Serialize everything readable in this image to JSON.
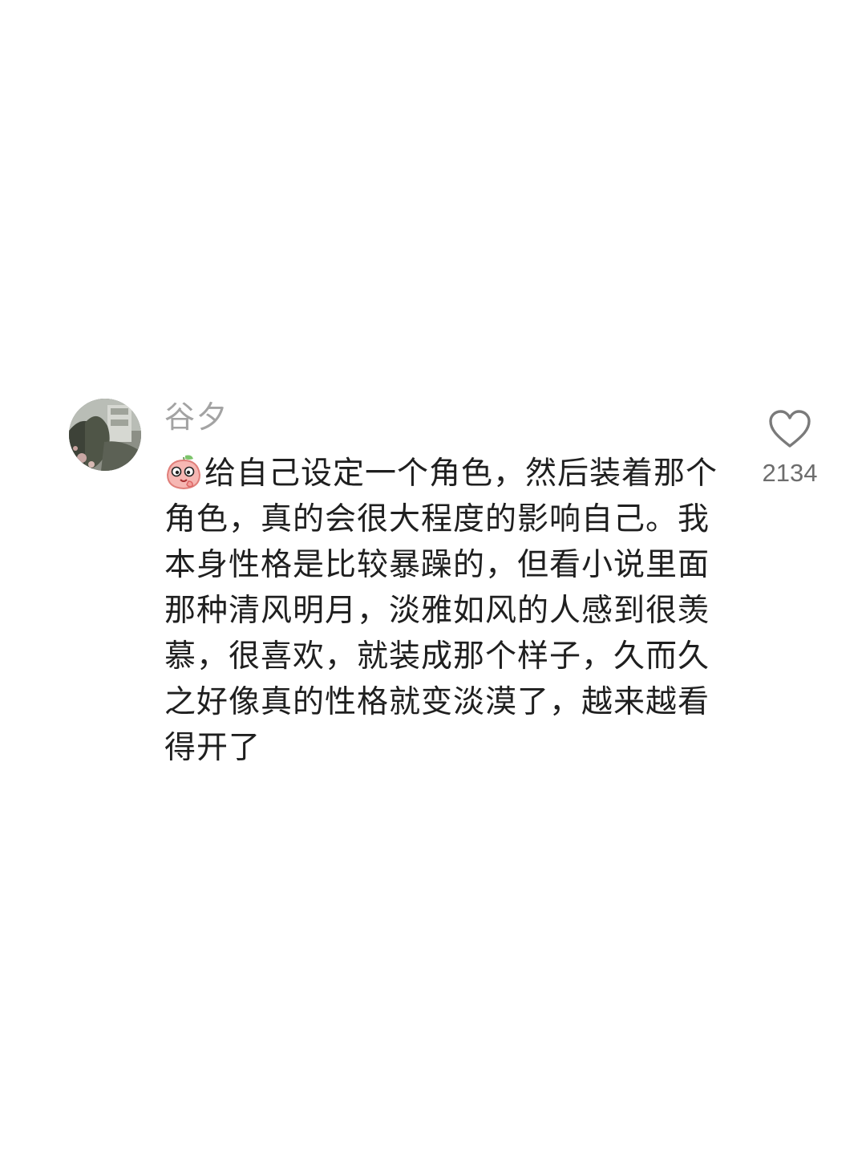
{
  "comment": {
    "username": "谷夕",
    "text": "给自己设定一个角色，然后装着那个角色，真的会很大程度的影响自己。我本身性格是比较暴躁的，但看小说里面那种清风明月，淡雅如风的人感到很羡慕，很喜欢，就装成那个样子，久而久之好像真的性格就变淡漠了，越来越看得开了",
    "emoji_icon": "peach-face-emoji-icon",
    "likes": {
      "count": "2134",
      "icon": "heart-outline-icon"
    }
  },
  "colors": {
    "background": "#ffffff",
    "username": "#a3a3a3",
    "text": "#1f1f1f",
    "like_count": "#6d6d6d",
    "heart_stroke": "#7a7a7a",
    "emoji_fill": "#f6b7b3"
  }
}
